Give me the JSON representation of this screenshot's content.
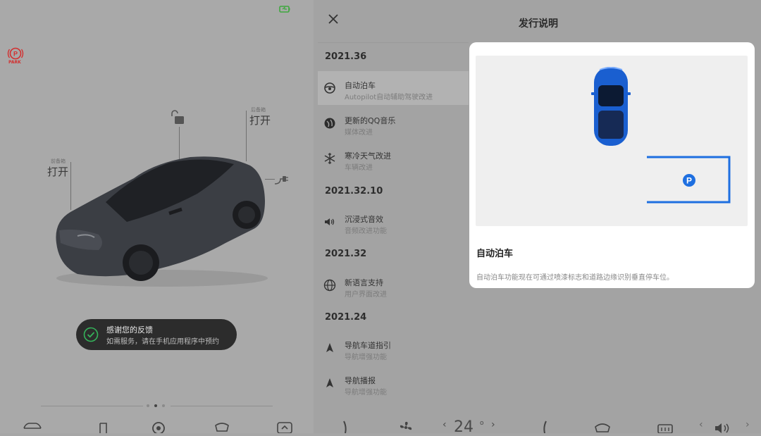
{
  "car_panel": {
    "park_label": "PARK",
    "frunk": {
      "small_label": "前备箱",
      "big_label": "打开"
    },
    "trunk": {
      "small_label": "后备箱",
      "big_label": "打开"
    },
    "toast": {
      "title": "感谢您的反馈",
      "subtitle": "如需服务，请在手机应用程序中预约"
    },
    "pager": {
      "count": 3,
      "active": 1
    }
  },
  "release_notes": {
    "title": "发行说明",
    "sections": [
      {
        "version": "2021.36",
        "items": [
          {
            "title": "自动泊车",
            "subtitle": "Autopilot自动辅助驾驶改进",
            "icon": "steering-wheel-icon",
            "selected": true
          },
          {
            "title": "更新的QQ音乐",
            "subtitle": "媒体改进",
            "icon": "music-app-icon"
          },
          {
            "title": "寒冷天气改进",
            "subtitle": "车辆改进",
            "icon": "snowflake-icon"
          }
        ]
      },
      {
        "version": "2021.32.10",
        "items": [
          {
            "title": "沉浸式音效",
            "subtitle": "音频改进功能",
            "icon": "speaker-icon"
          }
        ]
      },
      {
        "version": "2021.32",
        "items": [
          {
            "title": "新语言支持",
            "subtitle": "用户界面改进",
            "icon": "globe-icon"
          }
        ]
      },
      {
        "version": "2021.24",
        "items": [
          {
            "title": "导航车道指引",
            "subtitle": "导航增强功能",
            "icon": "navigation-arrow-icon"
          },
          {
            "title": "导航播报",
            "subtitle": "导航增强功能",
            "icon": "navigation-arrow-icon"
          }
        ]
      }
    ],
    "detail": {
      "title": "自动泊车",
      "description": "自动泊车功能现在可通过喷漆标志和道路边缘识别垂直停车位。",
      "parking_sign": "P"
    }
  },
  "bottom_bar": {
    "temperature": "24",
    "icons": [
      "car-icon",
      "music-icon",
      "camera-icon",
      "wiper-icon",
      "apps-icon",
      "seat-heater-icon",
      "fan-icon",
      "seat-heater-icon",
      "front-defrost-icon",
      "rear-defrost-icon",
      "volume-icon"
    ]
  },
  "colors": {
    "park_red": "#d32f2f",
    "battery_green": "#3fa83f",
    "check_green": "#35b35a",
    "tesla_blue": "#1a5fd0",
    "parking_blue": "#1e6fe0"
  }
}
